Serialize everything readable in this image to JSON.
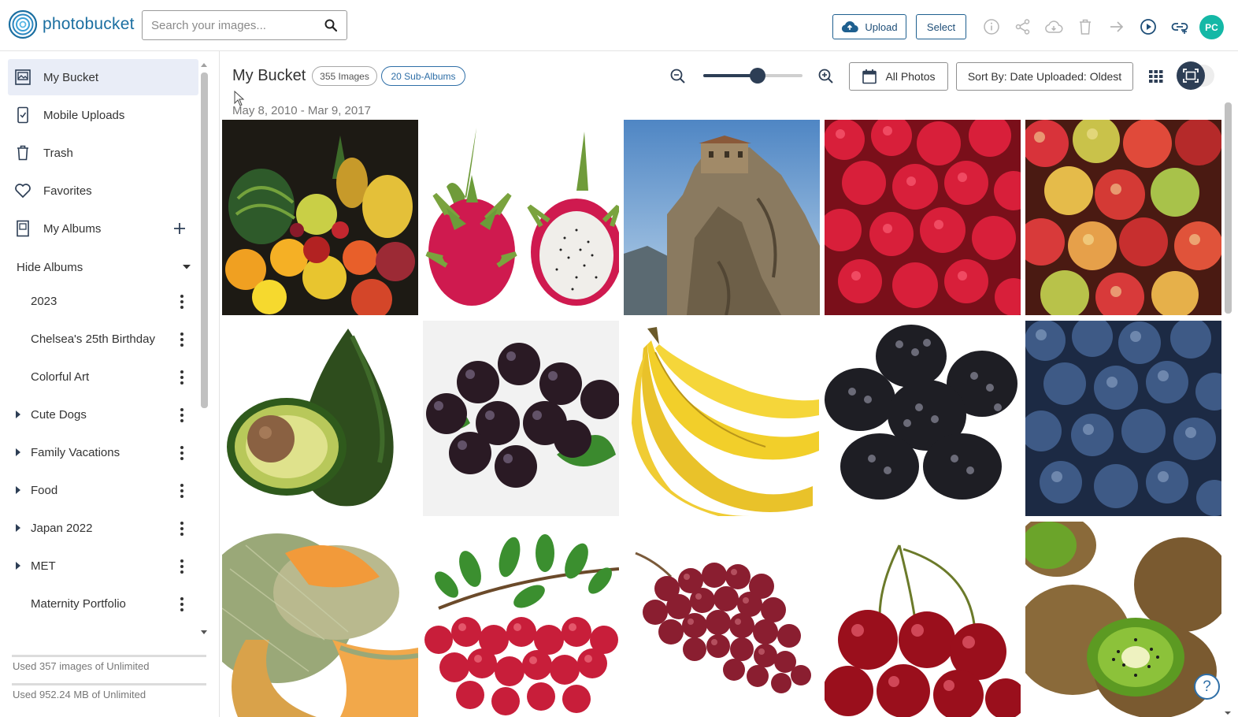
{
  "brand": {
    "name": "photobucket",
    "accent": "#1b6fa1"
  },
  "search": {
    "placeholder": "Search your images..."
  },
  "toolbar": {
    "upload_label": "Upload",
    "select_label": "Select",
    "icons": [
      "info-icon",
      "share-icon",
      "download-icon",
      "trash-icon",
      "move-icon",
      "slideshow-icon",
      "link-icon"
    ],
    "avatar_initials": "PC",
    "avatar_color": "#14b8a6"
  },
  "sidebar": {
    "nav": [
      {
        "label": "My Bucket",
        "icon": "my-bucket-icon",
        "active": true
      },
      {
        "label": "Mobile Uploads",
        "icon": "mobile-uploads-icon"
      },
      {
        "label": "Trash",
        "icon": "trash-icon"
      },
      {
        "label": "Favorites",
        "icon": "heart-icon"
      },
      {
        "label": "My Albums",
        "icon": "albums-icon"
      }
    ],
    "hide_albums_label": "Hide Albums",
    "albums": [
      {
        "label": "2023",
        "expandable": false
      },
      {
        "label": "Chelsea's 25th Birthday",
        "expandable": false
      },
      {
        "label": "Colorful Art",
        "expandable": false
      },
      {
        "label": "Cute Dogs",
        "expandable": true
      },
      {
        "label": "Family Vacations",
        "expandable": true
      },
      {
        "label": "Food",
        "expandable": true
      },
      {
        "label": "Japan 2022",
        "expandable": true
      },
      {
        "label": "MET",
        "expandable": true
      },
      {
        "label": "Maternity Portfolio",
        "expandable": false
      }
    ],
    "usage_images": "Used 357 images of Unlimited",
    "usage_storage": "Used 952.24 MB of Unlimited"
  },
  "main": {
    "title": "My Bucket",
    "image_count": "355 Images",
    "subalbum_count": "20 Sub-Albums",
    "zoom_level": 0.55,
    "filter_label": "All Photos",
    "sort_label": "Sort By: Date Uploaded: Oldest",
    "date_range": "May 8, 2010 - Mar 9, 2017",
    "help_label": "?",
    "photos": [
      {
        "subject": "mixed-fruit"
      },
      {
        "subject": "dragon-fruit"
      },
      {
        "subject": "cliff-monastery"
      },
      {
        "subject": "raspberries"
      },
      {
        "subject": "apples"
      },
      {
        "subject": "avocado"
      },
      {
        "subject": "acai-berries"
      },
      {
        "subject": "bananas"
      },
      {
        "subject": "blackberries"
      },
      {
        "subject": "blueberries"
      },
      {
        "subject": "cantaloupe"
      },
      {
        "subject": "cranberries"
      },
      {
        "subject": "grapes"
      },
      {
        "subject": "cherries"
      },
      {
        "subject": "kiwis"
      }
    ]
  }
}
